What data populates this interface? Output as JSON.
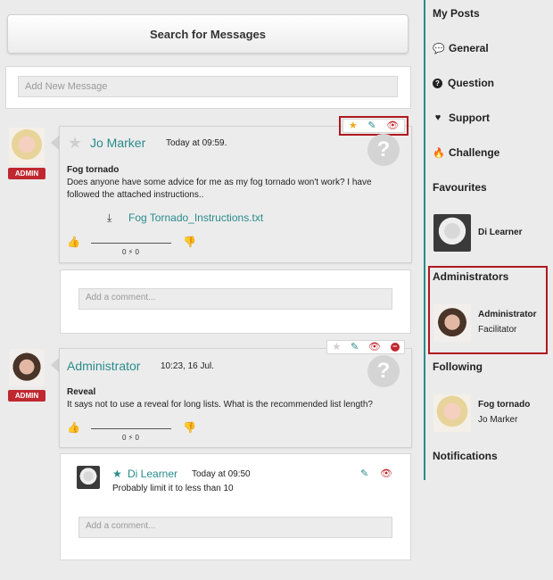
{
  "search": {
    "label": "Search for Messages"
  },
  "new_message": {
    "placeholder": "Add New Message"
  },
  "posts": [
    {
      "badge": "ADMIN",
      "author": "Jo Marker",
      "time": "Today at 09:59.",
      "title": "Fog tornado",
      "body": "Does anyone have some advice for me as my fog tornado won't work? I have followed the attached instructions..",
      "attachment": "Fog Tornado_Instructions.txt",
      "votes": "0 ⚡ 0",
      "comment_placeholder": "Add a comment..."
    },
    {
      "badge": "ADMIN",
      "author": "Administrator",
      "time": "10:23, 16 Jul.",
      "title": "Reveal",
      "body": "It says not to use a reveal for long lists. What is the recommended list length?",
      "votes": "0 ⚡ 0",
      "reply": {
        "author": "Di Learner",
        "time": "Today at 09:50",
        "text": "Probably limit it to less than 10"
      },
      "comment_placeholder": "Add a comment..."
    }
  ],
  "sidebar": {
    "my_posts": "My Posts",
    "categories": [
      {
        "label": "General",
        "icon": "speech-bubble-icon"
      },
      {
        "label": "Question",
        "icon": "question-circle-icon"
      },
      {
        "label": "Support",
        "icon": "heart-icon"
      },
      {
        "label": "Challenge",
        "icon": "flame-icon"
      }
    ],
    "favourites": {
      "heading": "Favourites",
      "person": {
        "name": "Di Learner"
      }
    },
    "administrators": {
      "heading": "Administrators",
      "person": {
        "name": "Administrator",
        "role": "Facilitator"
      }
    },
    "following": {
      "heading": "Following",
      "item": {
        "title": "Fog tornado",
        "author": "Jo Marker"
      }
    },
    "notifications": "Notifications"
  },
  "colors": {
    "accent": "#2a8b8b",
    "danger": "#c0282f",
    "star": "#f0a81e",
    "highlight": "#b0181f"
  }
}
